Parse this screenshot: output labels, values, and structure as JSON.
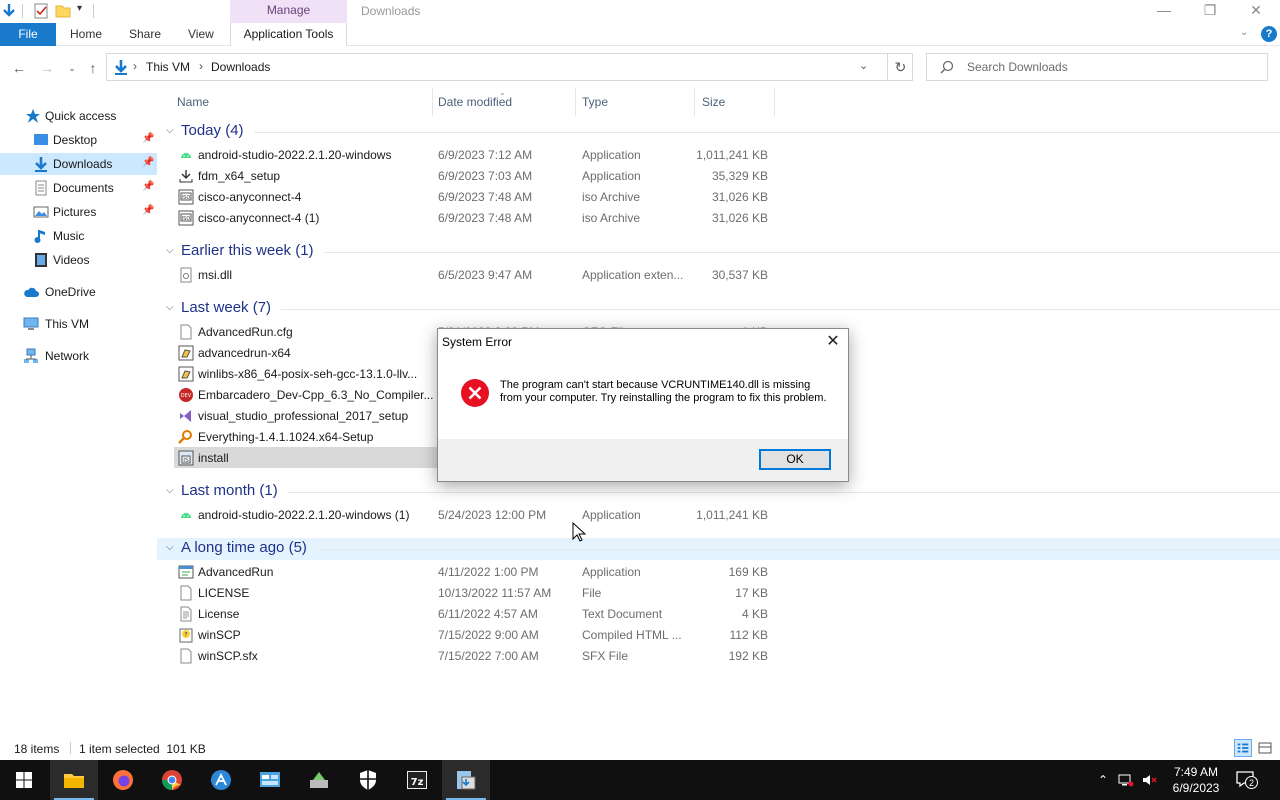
{
  "window": {
    "title": "Downloads",
    "contextual_tab": "Manage",
    "controls": {
      "minimize": "—",
      "maximize": "❐",
      "close": "✕"
    }
  },
  "ribbon": {
    "tabs": [
      "File",
      "Home",
      "Share",
      "View",
      "Application Tools"
    ],
    "help": "?"
  },
  "address": {
    "crumbs": [
      "This VM",
      "Downloads"
    ],
    "search_placeholder": "Search Downloads"
  },
  "nav": {
    "items": [
      {
        "label": "Quick access",
        "icon": "star-icon"
      },
      {
        "label": "Desktop",
        "icon": "desktop-folder-icon",
        "pinned": true
      },
      {
        "label": "Downloads",
        "icon": "downloads-folder-icon",
        "pinned": true,
        "selected": true
      },
      {
        "label": "Documents",
        "icon": "documents-folder-icon",
        "pinned": true
      },
      {
        "label": "Pictures",
        "icon": "pictures-folder-icon",
        "pinned": true
      },
      {
        "label": "Music",
        "icon": "music-folder-icon"
      },
      {
        "label": "Videos",
        "icon": "videos-folder-icon"
      },
      {
        "label": "OneDrive",
        "icon": "onedrive-cloud-icon"
      },
      {
        "label": "This VM",
        "icon": "computer-icon"
      },
      {
        "label": "Network",
        "icon": "network-icon"
      }
    ]
  },
  "columns": {
    "name": "Name",
    "date": "Date modified",
    "type": "Type",
    "size": "Size"
  },
  "groups": [
    {
      "label": "Today (4)",
      "files": [
        {
          "name": "android-studio-2022.2.1.20-windows",
          "date": "6/9/2023 7:12 AM",
          "type": "Application",
          "size": "1,011,241 KB",
          "icon": "android-icon"
        },
        {
          "name": "fdm_x64_setup",
          "date": "6/9/2023 7:03 AM",
          "type": "Application",
          "size": "35,329 KB",
          "icon": "download-arrow-icon"
        },
        {
          "name": "cisco-anyconnect-4",
          "date": "6/9/2023 7:48 AM",
          "type": "iso Archive",
          "size": "31,026 KB",
          "icon": "iso-archive-icon"
        },
        {
          "name": "cisco-anyconnect-4 (1)",
          "date": "6/9/2023 7:48 AM",
          "type": "iso Archive",
          "size": "31,026 KB",
          "icon": "iso-archive-icon"
        }
      ]
    },
    {
      "label": "Earlier this week (1)",
      "files": [
        {
          "name": "msi.dll",
          "date": "6/5/2023 9:47 AM",
          "type": "Application exten...",
          "size": "30,537 KB",
          "icon": "dll-file-icon"
        }
      ]
    },
    {
      "label": "Last week (7)",
      "files": [
        {
          "name": "AdvancedRun.cfg",
          "date": "5/31/2023 8:28 PM",
          "type": "CFG File",
          "size": "1 KB",
          "icon": "blank-file-icon"
        },
        {
          "name": "advancedrun-x64",
          "date": "",
          "type": "",
          "size": "",
          "icon": "zip-archive-icon"
        },
        {
          "name": "winlibs-x86_64-posix-seh-gcc-13.1.0-llv...",
          "date": "",
          "type": "",
          "size": "",
          "icon": "zip-archive-icon"
        },
        {
          "name": "Embarcadero_Dev-Cpp_6.3_No_Compiler...",
          "date": "",
          "type": "",
          "size": "",
          "icon": "devcpp-icon"
        },
        {
          "name": "visual_studio_professional_2017_setup",
          "date": "",
          "type": "",
          "size": "",
          "icon": "visual-studio-icon"
        },
        {
          "name": "Everything-1.4.1.1024.x64-Setup",
          "date": "",
          "type": "",
          "size": "",
          "icon": "magnifier-icon"
        },
        {
          "name": "install",
          "date": "",
          "type": "",
          "size": "",
          "icon": "installer-icon",
          "selected": true
        }
      ]
    },
    {
      "label": "Last month (1)",
      "files": [
        {
          "name": "android-studio-2022.2.1.20-windows (1)",
          "date": "5/24/2023 12:00 PM",
          "type": "Application",
          "size": "1,011,241 KB",
          "icon": "android-icon"
        }
      ]
    },
    {
      "label": "A long time ago (5)",
      "hot": true,
      "files": [
        {
          "name": "AdvancedRun",
          "date": "4/11/2022 1:00 PM",
          "type": "Application",
          "size": "169 KB",
          "icon": "app-window-icon"
        },
        {
          "name": "LICENSE",
          "date": "10/13/2022 11:57 AM",
          "type": "File",
          "size": "17 KB",
          "icon": "blank-file-icon"
        },
        {
          "name": "License",
          "date": "6/11/2022 4:57 AM",
          "type": "Text Document",
          "size": "4 KB",
          "icon": "text-file-icon"
        },
        {
          "name": "winSCP",
          "date": "7/15/2022 9:00 AM",
          "type": "Compiled HTML ...",
          "size": "112 KB",
          "icon": "chm-help-icon"
        },
        {
          "name": "winSCP.sfx",
          "date": "7/15/2022 7:00 AM",
          "type": "SFX File",
          "size": "192 KB",
          "icon": "blank-file-icon"
        }
      ]
    }
  ],
  "status": {
    "items": "18 items",
    "selection": "1 item selected  101 KB"
  },
  "dialog": {
    "title": "System Error",
    "message": "The program can't start because VCRUNTIME140.dll is missing from your computer. Try reinstalling the program to fix this problem.",
    "ok": "OK",
    "close": "✕"
  },
  "taskbar": {
    "apps": [
      "start-icon",
      "file-explorer-icon",
      "firefox-icon",
      "chrome-icon",
      "app-installer-icon",
      "control-panel-icon",
      "setup-tool-icon",
      "security-shield-icon",
      "7zip-icon",
      "installer-app-icon"
    ],
    "time": "7:49 AM",
    "date": "6/9/2023",
    "notifications": "2"
  },
  "colors": {
    "accent": "#1979ca",
    "group_header": "#1e3287",
    "selection": "#cce8ff",
    "error_red": "#e81123",
    "taskbar": "#101010"
  }
}
